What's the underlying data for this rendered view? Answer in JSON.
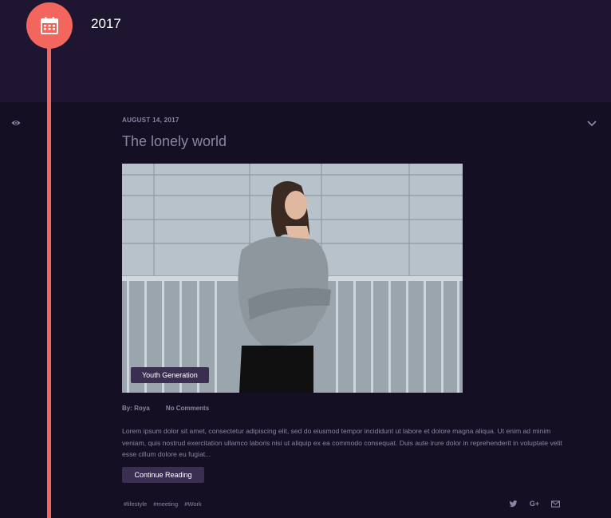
{
  "timeline": {
    "year": "2017",
    "badge_icon": "calendar-icon",
    "accent_color": "#f2665e"
  },
  "post": {
    "view_icon": "eye-icon",
    "toggle_icon": "chevron-down-icon",
    "date": "AUGUST 14, 2017",
    "title": "The lonely world",
    "image_alt": "Young woman in a grey knit sweater standing by a railing",
    "category": "Youth Generation",
    "author": "By: Roya",
    "comments": "No Comments",
    "excerpt": "Lorem ipsum dolor sit amet, consectetur adipiscing elit, sed do eiusmod tempor incididunt ut labore et dolore magna aliqua. Ut enim ad minim veniam, quis nostrud exercitation ullamco laboris nisi ut aliquip ex ea commodo consequat. Duis aute irure dolor in reprehenderit in voluptate velit esse cillum dolore eu fugiat...",
    "continue_label": "Continue Reading",
    "tags": [
      "#lifestyle",
      "#meeting",
      "#Work"
    ],
    "share": {
      "twitter_icon": "twitter-icon",
      "gplus_label": "G+",
      "mail_icon": "mail-icon"
    }
  }
}
